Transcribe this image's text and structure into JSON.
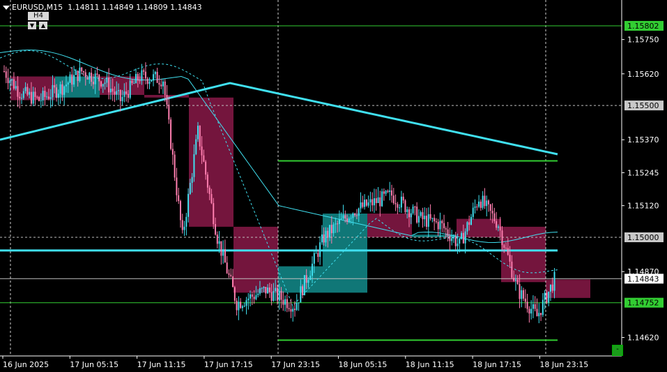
{
  "header": {
    "symbol": "EURUSD,M15",
    "ohlc": "1.14811 1.14849 1.14809 1.14843",
    "timeframe_label": "H4"
  },
  "chart_data": {
    "type": "candlestick",
    "ylim": [
      1.1455,
      1.159
    ],
    "y_ticks": [
      1.1575,
      1.1562,
      1.1537,
      1.15245,
      1.1512,
      1.1487,
      1.1462
    ],
    "x_ticks": [
      "16 Jun 2025",
      "17 Jun 05:15",
      "17 Jun 11:15",
      "17 Jun 17:15",
      "17 Jun 23:15",
      "18 Jun 05:15",
      "18 Jun 11:15",
      "18 Jun 17:15",
      "18 Jun 23:15"
    ],
    "price_tags": [
      {
        "value": "1.15802",
        "style": "green"
      },
      {
        "value": "1.15500",
        "style": "gray"
      },
      {
        "value": "1.15000",
        "style": "gray"
      },
      {
        "value": "1.14843",
        "style": "white"
      },
      {
        "value": "1.14752",
        "style": "green"
      },
      {
        "value": "1.14620",
        "style": "green"
      }
    ],
    "levels": [
      {
        "name": "top-green-level",
        "price": 1.15802,
        "color": "#32cd32"
      },
      {
        "name": "dashed-level-1",
        "price": 1.155,
        "color": "#c0c0c0",
        "dashed": true
      },
      {
        "name": "range-high-level",
        "price": 1.1529,
        "color": "#32cd32"
      },
      {
        "name": "dashed-level-2",
        "price": 1.15,
        "color": "#c0c0c0",
        "dashed": true
      },
      {
        "name": "cyan-horizontal-level",
        "price": 1.1495,
        "color": "#40e0f0"
      },
      {
        "name": "current-price-line",
        "price": 1.14843,
        "color": "#c0c0c0"
      },
      {
        "name": "green-level-low",
        "price": 1.14752,
        "color": "#32cd32"
      },
      {
        "name": "range-low-level",
        "price": 1.1461,
        "color": "#32cd32"
      }
    ],
    "h4_boxes": [
      {
        "open": 1.1561,
        "close": 1.1552,
        "high": 1.1565,
        "low": 1.155
      },
      {
        "open": 1.1553,
        "close": 1.1561,
        "high": 1.1566,
        "low": 1.1549
      },
      {
        "open": 1.1561,
        "close": 1.1554,
        "high": 1.1569,
        "low": 1.155
      },
      {
        "open": 1.1554,
        "close": 1.1553,
        "high": 1.1576,
        "low": 1.1549
      },
      {
        "open": 1.1553,
        "close": 1.1504,
        "high": 1.1553,
        "low": 1.1502
      },
      {
        "open": 1.1504,
        "close": 1.1479,
        "high": 1.1521,
        "low": 1.1475
      },
      {
        "open": 1.1479,
        "close": 1.1489,
        "high": 1.1491,
        "low": 1.1473
      },
      {
        "open": 1.1479,
        "close": 1.1509,
        "high": 1.1513,
        "low": 1.1475
      },
      {
        "open": 1.1509,
        "close": 1.15,
        "high": 1.1526,
        "low": 1.1492
      },
      {
        "open": 1.15,
        "close": 1.1501,
        "high": 1.152,
        "low": 1.149
      },
      {
        "open": 1.1507,
        "close": 1.15,
        "high": 1.1529,
        "low": 1.1486
      },
      {
        "open": 1.1504,
        "close": 1.1483,
        "high": 1.1527,
        "low": 1.1462
      },
      {
        "open": 1.1484,
        "close": 1.1477,
        "high": 1.1485,
        "low": 1.1465
      }
    ]
  }
}
